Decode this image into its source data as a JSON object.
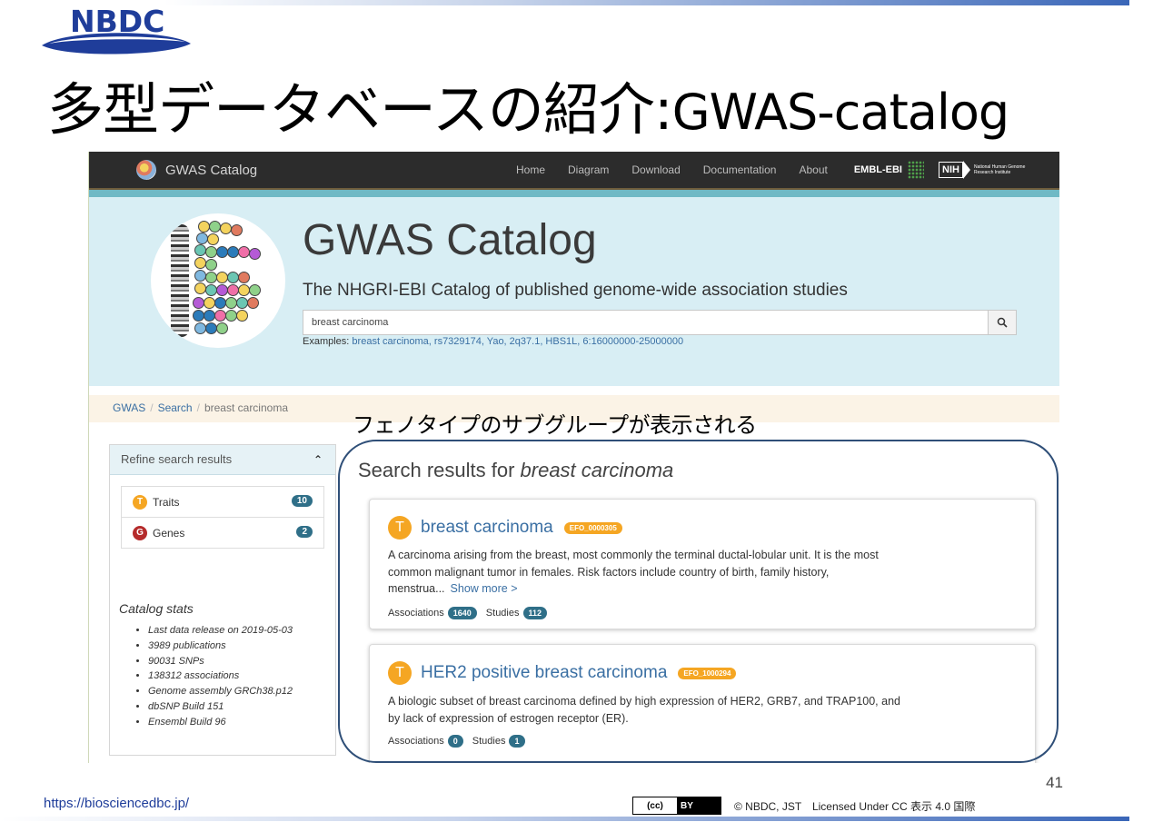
{
  "slide": {
    "logo_text": "NBDC",
    "title_jp": "多型データベースの紹介",
    "title_sep": ":",
    "title_latin": "GWAS-catalog",
    "callout": "フェノタイプのサブグループが表示される",
    "page_number": "41",
    "footer_url": "https://biosciencedbc.jp/",
    "cc_left": "(cc)",
    "cc_right": "BY",
    "license": "© NBDC, JST　Licensed Under CC 表示 4.0 国際",
    "accent_color": "#1f3d9a"
  },
  "nav": {
    "brand": "GWAS Catalog",
    "links": [
      "Home",
      "Diagram",
      "Download",
      "Documentation",
      "About"
    ],
    "ebi": "EMBL-EBI",
    "nih": "NIH",
    "nih_text": "National Human Genome Research Institute"
  },
  "jumbotron": {
    "title": "GWAS Catalog",
    "subtitle": "The NHGRI-EBI Catalog of published genome-wide association studies",
    "search_value": "breast carcinoma",
    "examples_label": "Examples: ",
    "examples": "breast carcinoma, rs7329174, Yao, 2q37.1, HBS1L, 6:16000000-25000000"
  },
  "breadcrumb": {
    "items": [
      "GWAS",
      "Search",
      "breast carcinoma"
    ],
    "sep": "/"
  },
  "sidebar": {
    "refine_title": "Refine search results",
    "facets": [
      {
        "badge": "T",
        "label": "Traits",
        "count": "10",
        "color": "#f5a623"
      },
      {
        "badge": "G",
        "label": "Genes",
        "count": "2",
        "color": "#b52b2b"
      }
    ],
    "stats_title": "Catalog stats",
    "stats": [
      "Last data release on 2019-05-03",
      "3989 publications",
      "90031 SNPs",
      "138312 associations",
      "Genome assembly GRCh38.p12",
      "dbSNP Build 151",
      "Ensembl Build 96"
    ]
  },
  "results": {
    "heading_prefix": "Search results for ",
    "heading_query": "breast carcinoma",
    "cards": [
      {
        "badge": "T",
        "title": "breast carcinoma",
        "efo": "EFO_0000305",
        "desc_lines": [
          "A carcinoma arising from the breast, most commonly the terminal ductal-lobular unit. It is the most",
          "common malignant tumor in females. Risk factors include country of birth, family history,",
          "menstrua..."
        ],
        "show_more": "Show more >",
        "assoc_label": "Associations",
        "assoc_count": "1640",
        "studies_label": "Studies",
        "studies_count": "112"
      },
      {
        "badge": "T",
        "title": "HER2 positive breast carcinoma",
        "efo": "EFO_1000294",
        "desc_lines": [
          "A biologic subset of breast carcinoma defined by high expression of HER2, GRB7, and TRAP100, and",
          "by lack of expression of estrogen receptor (ER)."
        ],
        "assoc_label": "Associations",
        "assoc_count": "0",
        "studies_label": "Studies",
        "studies_count": "1"
      }
    ]
  }
}
